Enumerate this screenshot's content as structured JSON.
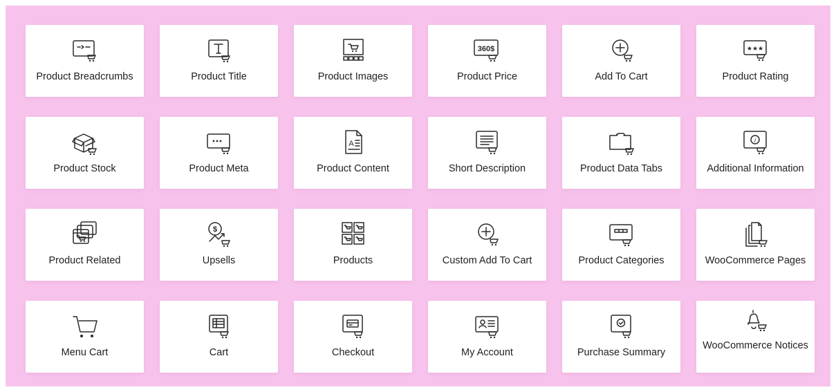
{
  "widgets": [
    {
      "label": "Product Breadcrumbs",
      "icon": "breadcrumbs-icon"
    },
    {
      "label": "Product Title",
      "icon": "title-icon"
    },
    {
      "label": "Product Images",
      "icon": "images-icon"
    },
    {
      "label": "Product Price",
      "icon": "price-icon",
      "icon_text": "360$"
    },
    {
      "label": "Add To Cart",
      "icon": "add-to-cart-icon"
    },
    {
      "label": "Product Rating",
      "icon": "rating-icon"
    },
    {
      "label": "Product Stock",
      "icon": "stock-icon"
    },
    {
      "label": "Product Meta",
      "icon": "meta-icon"
    },
    {
      "label": "Product Content",
      "icon": "content-icon"
    },
    {
      "label": "Short Description",
      "icon": "short-description-icon"
    },
    {
      "label": "Product Data Tabs",
      "icon": "data-tabs-icon"
    },
    {
      "label": "Additional Information",
      "icon": "info-icon"
    },
    {
      "label": "Product Related",
      "icon": "related-icon"
    },
    {
      "label": "Upsells",
      "icon": "upsells-icon"
    },
    {
      "label": "Products",
      "icon": "products-grid-icon"
    },
    {
      "label": "Custom Add To Cart",
      "icon": "custom-add-to-cart-icon"
    },
    {
      "label": "Product Categories",
      "icon": "categories-icon"
    },
    {
      "label": "WooCommerce Pages",
      "icon": "pages-icon"
    },
    {
      "label": "Menu Cart",
      "icon": "menu-cart-icon"
    },
    {
      "label": "Cart",
      "icon": "cart-icon"
    },
    {
      "label": "Checkout",
      "icon": "checkout-icon"
    },
    {
      "label": "My Account",
      "icon": "my-account-icon"
    },
    {
      "label": "Purchase Summary",
      "icon": "purchase-summary-icon"
    },
    {
      "label": "WooCommerce Notices",
      "icon": "notices-bell-icon"
    }
  ],
  "colors": {
    "background": "#f7c3ec",
    "card": "#ffffff",
    "text": "#1f1f1f",
    "icon": "#2a2a2a"
  }
}
